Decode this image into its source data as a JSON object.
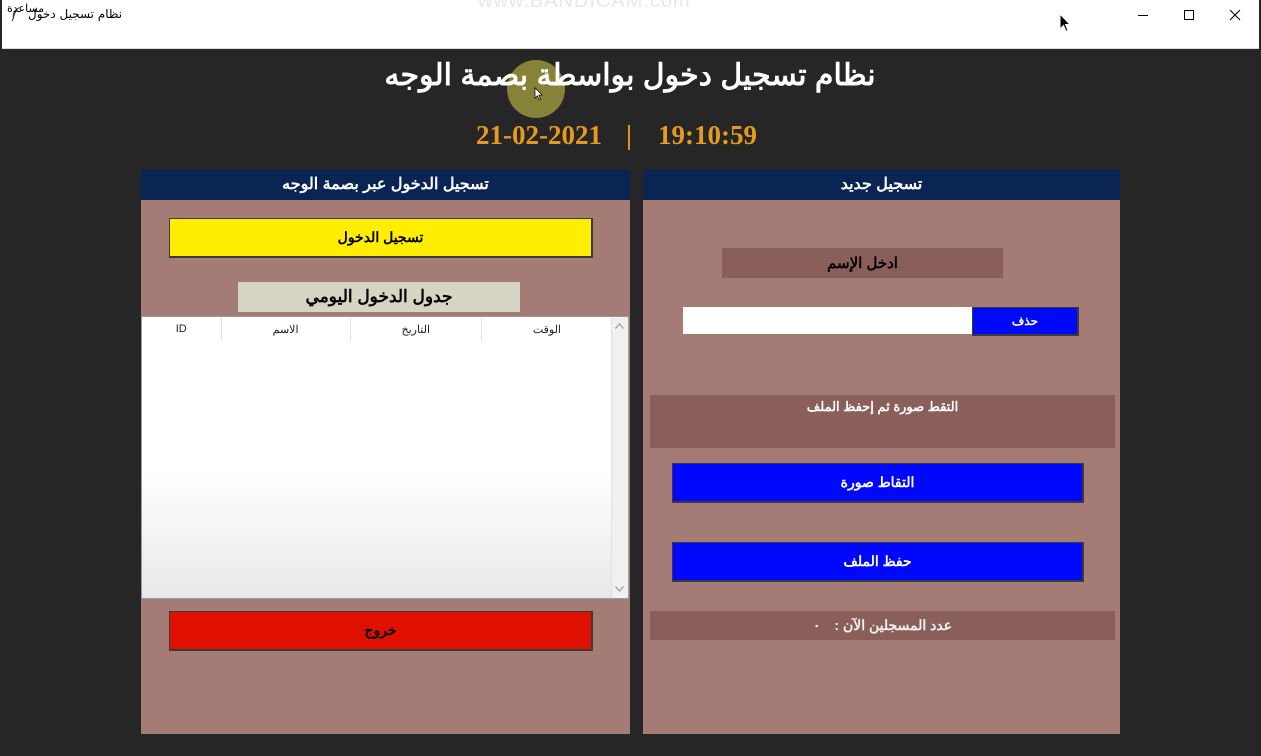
{
  "window": {
    "title": "نظام تسجيل دخول",
    "watermark": "www.BANDICAM.com",
    "menu_help": "مساعدة"
  },
  "header": {
    "title": "نظام تسجيل دخول بواسطة بصمة الوجه",
    "date": "21-02-2021",
    "separator": "|",
    "time": "19:10:59"
  },
  "left_panel": {
    "heading": "تسجيل الدخول عبر بصمة الوجه",
    "login_button": "تسجيل الدخول",
    "table_title": "جدول الدخول اليومي",
    "columns": [
      "ID",
      "الاسم",
      "التاريخ",
      "الوقت"
    ],
    "rows": [],
    "exit_button": "خروج"
  },
  "right_panel": {
    "heading": "تسجيل جديد",
    "enter_name_label": "ادخل الإسم",
    "name_input_value": "",
    "delete_button": "حذف",
    "capture_instruction": "التقط صورة ثم إحفظ الملف",
    "capture_button": "التقاط صورة",
    "save_button": "حفظ الملف",
    "registered_count_label": "عدد المسجلين الآن :",
    "registered_count_value": "٠"
  },
  "colors": {
    "background": "#262626",
    "panel": "#a57b76",
    "panel_header": "#0a2554",
    "label_box": "#8a5f5a",
    "login_button": "#ffee00",
    "exit_button": "#e01000",
    "action_button": "#0008fb",
    "datetime": "#e59b1d"
  }
}
